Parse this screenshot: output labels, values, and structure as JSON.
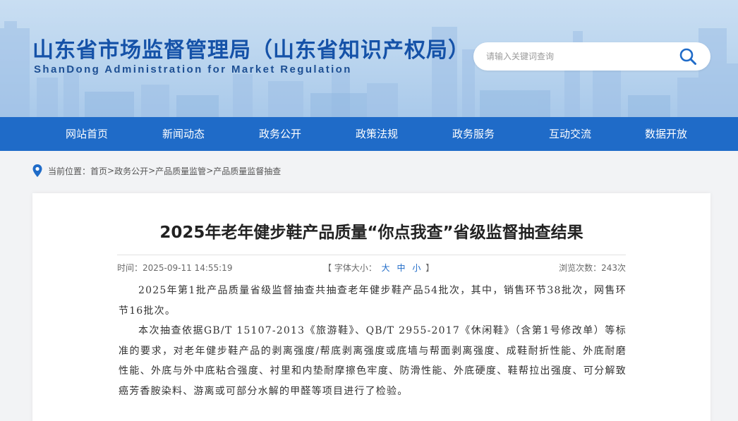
{
  "header": {
    "title_cn": "山东省市场监督管理局（山东省知识产权局）",
    "title_en": "ShanDong Administration for Market Regulation"
  },
  "search": {
    "placeholder": "请输入关键词查询",
    "icon": "search-icon"
  },
  "nav": {
    "items": [
      {
        "label": "网站首页"
      },
      {
        "label": "新闻动态"
      },
      {
        "label": "政务公开"
      },
      {
        "label": "政策法规"
      },
      {
        "label": "政务服务"
      },
      {
        "label": "互动交流"
      },
      {
        "label": "数据开放"
      }
    ]
  },
  "breadcrumb": {
    "prefix": "当前位置：",
    "items": [
      "首页",
      "政务公开",
      "产品质量监管",
      "产品质量监督抽查"
    ],
    "separator": ">"
  },
  "article": {
    "title": "2025年老年健步鞋产品质量“你点我查”省级监督抽查结果",
    "time_label": "时间：2025-09-11 14:55:19",
    "font_size_label": "【 字体大小：",
    "font_size_close": " 】",
    "font_sizes": [
      "大",
      "中",
      "小"
    ],
    "views_label": "浏览次数：243次",
    "paragraphs": [
      "2025年第1批产品质量省级监督抽查共抽查老年健步鞋产品54批次，其中，销售环节38批次，网售环节16批次。",
      "本次抽查依据GB/T 15107-2013《旅游鞋》、QB/T 2955-2017《休闲鞋》（含第1号修改单）等标准的要求，对老年健步鞋产品的剥离强度/帮底剥离强度或底墙与帮面剥离强度、成鞋耐折性能、外底耐磨性能、外底与外中底粘合强度、衬里和内垫耐摩擦色牢度、防滑性能、外底硬度、鞋帮拉出强度、可分解致癌芳香胺染料、游离或可部分水解的甲醛等项目进行了检验。"
    ]
  },
  "colors": {
    "nav_bg": "#1f6bc8",
    "title_blue": "#1552a8",
    "accent": "#1f6bc8"
  }
}
